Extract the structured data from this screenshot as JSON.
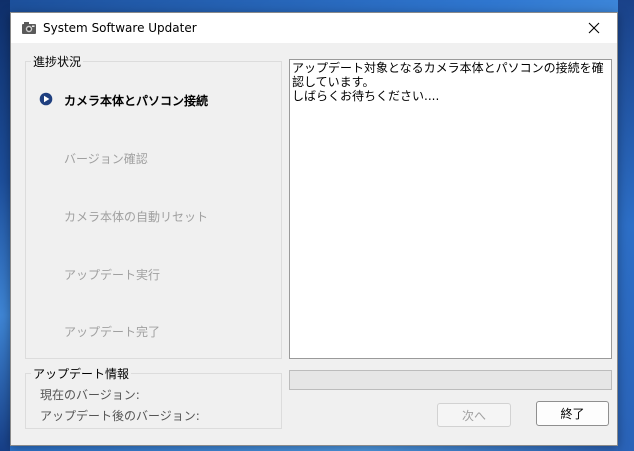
{
  "window": {
    "title": "System Software Updater",
    "close_icon": "close-icon",
    "app_icon": "updater-app-icon"
  },
  "progress_panel": {
    "legend": "進捗状況",
    "steps": [
      {
        "label": "カメラ本体とパソコン接続",
        "state": "active"
      },
      {
        "label": "バージョン確認",
        "state": "pending"
      },
      {
        "label": "カメラ本体の自動リセット",
        "state": "pending"
      },
      {
        "label": "アップデート実行",
        "state": "pending"
      },
      {
        "label": "アップデート完了",
        "state": "pending"
      }
    ]
  },
  "message": {
    "line1": "アップデート対象となるカメラ本体とパソコンの接続を確認しています。",
    "line2": "しばらくお待ちください...."
  },
  "update_info": {
    "legend": "アップデート情報",
    "current_version_label": "現在のバージョン:",
    "after_version_label": "アップデート後のバージョン:"
  },
  "progress": {
    "value": 0
  },
  "buttons": {
    "next_label": "次へ",
    "next_enabled": false,
    "finish_label": "終了"
  },
  "colors": {
    "active_step_arrow": "#1f3f7f",
    "inactive_text": "#a0a0a0",
    "progress_fill": "#06b025"
  }
}
